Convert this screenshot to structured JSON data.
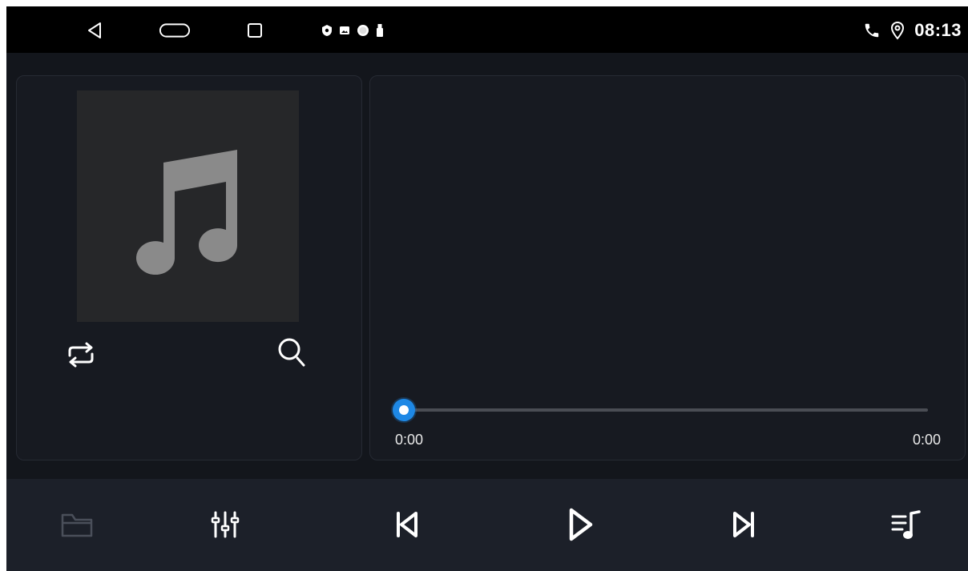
{
  "status_bar": {
    "time": "08:13",
    "nav_icons": [
      "back-icon",
      "home-icon",
      "recents-icon"
    ],
    "notification_icons": [
      "shield-icon",
      "image-icon",
      "circle-icon",
      "usb-icon"
    ],
    "right_icons": [
      "phone-icon",
      "location-pin-icon"
    ]
  },
  "player": {
    "album_art_icon": "music-note-icon",
    "repeat_icon": "repeat-icon",
    "search_icon": "search-icon",
    "elapsed": "0:00",
    "duration": "0:00",
    "progress": 0
  },
  "controls": {
    "items": [
      "folder-icon",
      "equalizer-icon",
      "skip-previous-icon",
      "play-icon",
      "skip-next-icon",
      "playlist-icon"
    ]
  },
  "colors": {
    "accent": "#1e88e5",
    "background": "#13161c",
    "control_bar": "#1c2029",
    "status_bar": "#000000"
  }
}
